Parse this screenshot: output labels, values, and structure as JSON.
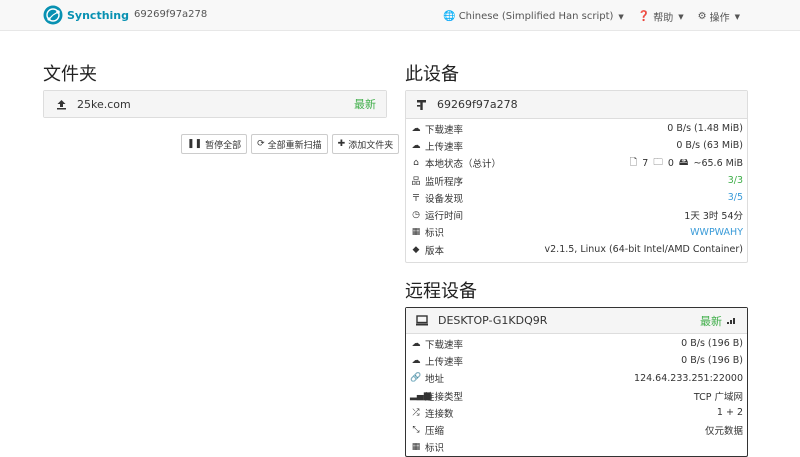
{
  "nav": {
    "brand": "Syncthing",
    "device_id": "69269f97a278",
    "language": "Chinese (Simplified Han script)",
    "help": "帮助",
    "actions": "操作"
  },
  "folders": {
    "title": "文件夹",
    "items": [
      {
        "name": "25ke.com",
        "status": "最新"
      }
    ],
    "buttons": {
      "pause_all": "暂停全部",
      "rescan_all": "全部重新扫描",
      "add_folder": "添加文件夹"
    }
  },
  "this_device": {
    "title": "此设备",
    "name": "69269f97a278",
    "rows": [
      {
        "icon": "cloud-download-icon",
        "label": "下载速率",
        "value": "0 B/s (1.48 MiB)"
      },
      {
        "icon": "cloud-upload-icon",
        "label": "上传速率",
        "value": "0 B/s (63 MiB)"
      },
      {
        "icon": "home-icon",
        "label": "本地状态（总计）",
        "files": "7",
        "dirs": "0",
        "size": "~65.6 MiB"
      },
      {
        "icon": "sitemap-icon",
        "label": "监听程序",
        "value": "3/3"
      },
      {
        "icon": "signpost-icon",
        "label": "设备发现",
        "value": "3/5"
      },
      {
        "icon": "clock-icon",
        "label": "运行时间",
        "value": "1天 3时 54分"
      },
      {
        "icon": "qrcode-icon",
        "label": "标识",
        "value": "WWPWAHY"
      },
      {
        "icon": "tag-icon",
        "label": "版本",
        "value": "v2.1.5, Linux (64-bit Intel/AMD Container)"
      }
    ]
  },
  "remote_devices": {
    "title": "远程设备",
    "devices": [
      {
        "name": "DESKTOP-G1KDQ9R",
        "status": "最新",
        "rows": [
          {
            "icon": "cloud-download-icon",
            "label": "下载速率",
            "value": "0 B/s (196 B)"
          },
          {
            "icon": "cloud-upload-icon",
            "label": "上传速率",
            "value": "0 B/s (196 B)"
          },
          {
            "icon": "link-icon",
            "label": "地址",
            "value": "124.64.233.251:22000"
          },
          {
            "icon": "signal-icon",
            "label": "连接类型",
            "value": "TCP 广域网"
          },
          {
            "icon": "shuffle-icon",
            "label": "连接数",
            "value": "1 + 2"
          },
          {
            "icon": "compress-icon",
            "label": "压缩",
            "value": "仅元数据"
          },
          {
            "icon": "qrcode-icon",
            "label": "标识",
            "value": ""
          }
        ]
      }
    ]
  },
  "colors": {
    "brand": "#0891b2",
    "ok": "#3fae49",
    "link": "#3a9bd8"
  }
}
